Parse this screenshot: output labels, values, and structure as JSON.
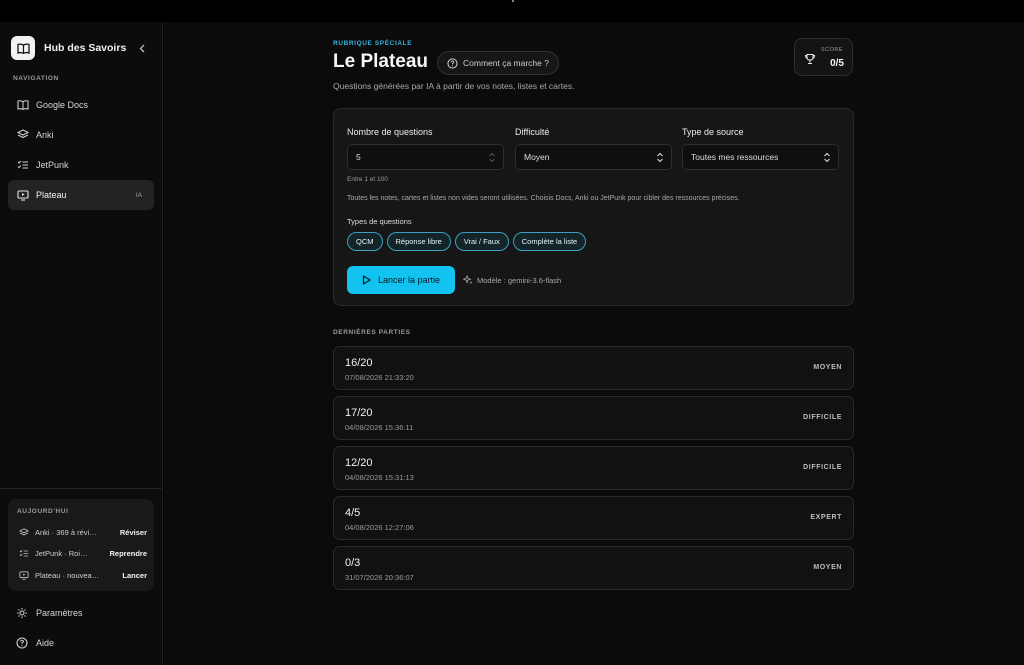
{
  "app": {
    "name": "Hub des Savoirs"
  },
  "sidebar": {
    "section_label": "NAVIGATION",
    "items": [
      {
        "label": "Google Docs",
        "icon": "book-icon"
      },
      {
        "label": "Anki",
        "icon": "layers-icon"
      },
      {
        "label": "JetPunk",
        "icon": "checklist-icon"
      },
      {
        "label": "Plateau",
        "icon": "tv-icon",
        "badge": "IA",
        "active": true
      }
    ],
    "today": {
      "label": "AUJOURD'HUI",
      "rows": [
        {
          "text": "Anki · 369 à révi…",
          "action": "Réviser",
          "icon": "layers-icon"
        },
        {
          "text": "JetPunk · Roi…",
          "action": "Reprendre",
          "icon": "checklist-icon"
        },
        {
          "text": "Plateau · nouvea…",
          "action": "Lancer",
          "icon": "tv-icon"
        }
      ]
    },
    "bottom": [
      {
        "label": "Paramètres",
        "icon": "gear-icon"
      },
      {
        "label": "Aide",
        "icon": "help-icon"
      }
    ]
  },
  "header": {
    "eyebrow": "RUBRIQUE SPÉCIALE",
    "title": "Le Plateau",
    "how_button": "Comment ça marche ?",
    "subtitle": "Questions générées par IA à partir de vos notes, listes et cartes.",
    "score_label": "SCORE",
    "score_value": "0/5"
  },
  "config": {
    "questions_label": "Nombre de questions",
    "questions_value": "5",
    "questions_hint": "Entre 1 et 100",
    "difficulty_label": "Difficulté",
    "difficulty_value": "Moyen",
    "source_label": "Type de source",
    "source_value": "Toutes mes ressources",
    "info": "Toutes les notes, cartes et listes non vides seront utilisées. Choisis Docs, Anki ou JetPunk pour cibler des ressources précises.",
    "types_label": "Types de questions",
    "types": [
      "QCM",
      "Réponse libre",
      "Vrai / Faux",
      "Complète la liste"
    ],
    "launch_label": "Lancer la partie",
    "model_text": "Modèle : gemini-3.6-flash"
  },
  "recent": {
    "label": "DERNIÈRES PARTIES",
    "games": [
      {
        "score": "16/20",
        "date": "07/08/2026 21:33:20",
        "level": "MOYEN"
      },
      {
        "score": "17/20",
        "date": "04/08/2026 15:36:11",
        "level": "DIFFICILE"
      },
      {
        "score": "12/20",
        "date": "04/08/2026 15:31:13",
        "level": "DIFFICILE"
      },
      {
        "score": "4/5",
        "date": "04/08/2026 12:27:06",
        "level": "EXPERT"
      },
      {
        "score": "0/3",
        "date": "31/07/2026 20:36:07",
        "level": "MOYEN"
      }
    ]
  },
  "colors": {
    "accent": "#12c3f2",
    "eyebrow": "#37b6e6",
    "chip_border": "#3aa0c2"
  }
}
